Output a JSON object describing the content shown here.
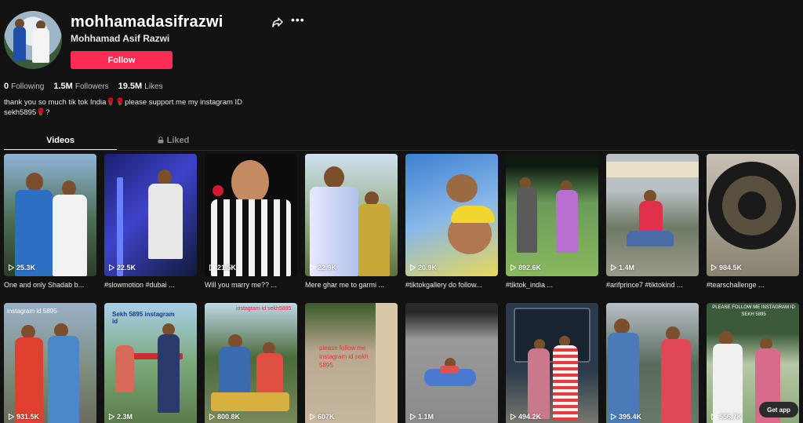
{
  "profile": {
    "username": "mohhamadasifrazwi",
    "display_name": "Mohhamad Asif Razwi",
    "follow_label": "Follow",
    "stats": [
      {
        "value": "0",
        "label": "Following"
      },
      {
        "value": "1.5M",
        "label": "Followers"
      },
      {
        "value": "19.5M",
        "label": "Likes"
      }
    ],
    "bio_line1": "thank you so much tik tok India🌹🌹please support me my instagram ID",
    "bio_line2": "sekh5895🌹?"
  },
  "tabs": [
    {
      "label": "Videos",
      "active": true
    },
    {
      "label": "Liked",
      "active": false,
      "icon": "lock-icon"
    }
  ],
  "videos_row1": [
    {
      "views": "25.3K",
      "caption": "One and only Shadab b..."
    },
    {
      "views": "22.5K",
      "caption": "#slowmotion #dubai ..."
    },
    {
      "views": "21.5K",
      "caption": "Will you marry me?? ..."
    },
    {
      "views": "22.9K",
      "caption": "Mere ghar me to garmi ..."
    },
    {
      "views": "20.9K",
      "caption": "#tiktokgallery do follow..."
    },
    {
      "views": "892.6K",
      "caption": "#tiktok_india ..."
    },
    {
      "views": "1.4M",
      "caption": "#arifprince7 #tiktokind ..."
    },
    {
      "views": "984.5K",
      "caption": "#tearschallenge ..."
    }
  ],
  "videos_row2": [
    {
      "views": "931.5K",
      "overlay": "instagram id 5895"
    },
    {
      "views": "2.3M",
      "overlay": "Sekh 5895 instagram id"
    },
    {
      "views": "800.8K",
      "overlay": "instagram id sekh5895"
    },
    {
      "views": "607K",
      "overlay": "please follow me instagram id sekh 5895"
    },
    {
      "views": "1.1M",
      "overlay": ""
    },
    {
      "views": "494.2K",
      "overlay": ""
    },
    {
      "views": "395.4K",
      "overlay": ""
    },
    {
      "views": "556.7K",
      "overlay": "PLEASE FOLLOW ME INSTAGRAM ID SEKH 5895"
    }
  ],
  "get_app_label": "Get app",
  "colors": {
    "accent": "#fe2c55",
    "background": "#121212"
  }
}
